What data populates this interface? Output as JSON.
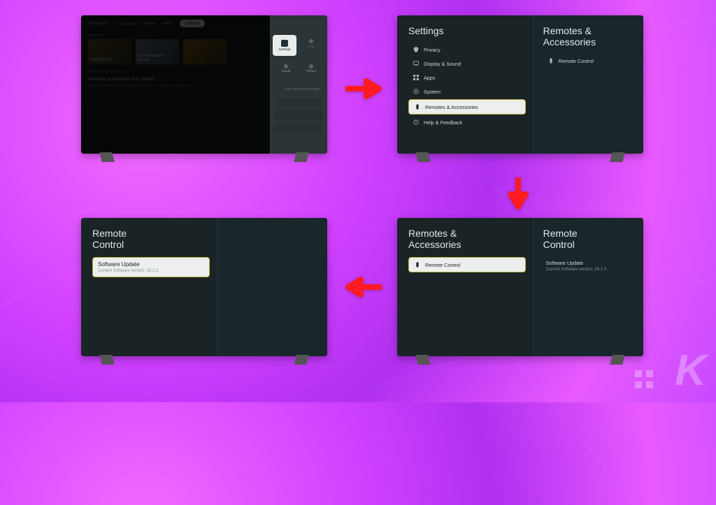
{
  "tv1": {
    "brand": "Google TV",
    "nav": {
      "search": "Search",
      "home": "Home",
      "apps": "Apps",
      "library": "Library"
    },
    "watchlist_label": "Watchlist",
    "cards": [
      "THE RACER",
      "Sinéad Lohan's Bicycle",
      ""
    ],
    "section_label": "Movies and TV shows",
    "manage_title": "Manage purchases and rentals",
    "manage_desc": "Content rented or purchased on Google TV will be available here.",
    "settings_tile": "Settings",
    "side_tiles": [
      "",
      "Inputs",
      "Picture"
    ],
    "no_notifications": "NO NOTIFICATIONS"
  },
  "tv2": {
    "left_title": "Settings",
    "items": [
      {
        "icon": "shield",
        "label": "Privacy"
      },
      {
        "icon": "display",
        "label": "Display & Sound"
      },
      {
        "icon": "apps",
        "label": "Apps"
      },
      {
        "icon": "system",
        "label": "System"
      },
      {
        "icon": "remote",
        "label": "Remotes & Accessories",
        "selected": true
      },
      {
        "icon": "help",
        "label": "Help & Feedback"
      }
    ],
    "right_title": "Remotes &\nAccessories",
    "right_item": {
      "icon": "remote",
      "label": "Remote Control"
    }
  },
  "tv3": {
    "left_title": "Remotes &\nAccessories",
    "left_item": {
      "icon": "remote",
      "label": "Remote Control",
      "selected": true
    },
    "right_title": "Remote\nControl",
    "right_item_title": "Software Update",
    "right_item_sub": "Current Software version: 28.2.3"
  },
  "tv4": {
    "left_title": "Remote\nControl",
    "left_item_title": "Software Update",
    "left_item_sub": "Current Software version: 28.2.2"
  },
  "watermark": "K"
}
